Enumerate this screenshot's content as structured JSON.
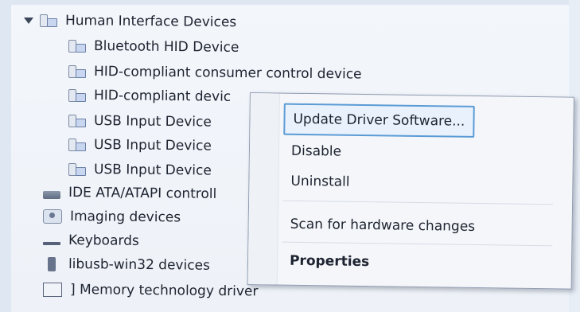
{
  "tree": {
    "category": "Human Interface Devices",
    "children": [
      "Bluetooth HID Device",
      "HID-compliant consumer control device",
      "HID-compliant devic",
      "USB Input Device",
      "USB Input Device",
      "USB Input Device"
    ],
    "siblings": [
      {
        "label": "IDE ATA/ATAPI controll",
        "icon": "ide-controller-icon"
      },
      {
        "label": "Imaging devices",
        "icon": "camera-icon"
      },
      {
        "label": "Keyboards",
        "icon": "keyboard-icon"
      },
      {
        "label": "libusb-win32 devices",
        "icon": "usb-icon"
      },
      {
        "label": "] Memory technology driver",
        "icon": "memory-icon"
      }
    ]
  },
  "context_menu": {
    "items": [
      {
        "label": "Update Driver Software...",
        "highlighted": true
      },
      {
        "label": "Disable"
      },
      {
        "label": "Uninstall"
      },
      {
        "label": "Scan for hardware changes"
      },
      {
        "label": "Properties",
        "bold": true
      }
    ]
  },
  "colors": {
    "highlight_border": "#5b9bd5",
    "menu_bg": "#f4f6f9",
    "text": "#1d2330"
  }
}
